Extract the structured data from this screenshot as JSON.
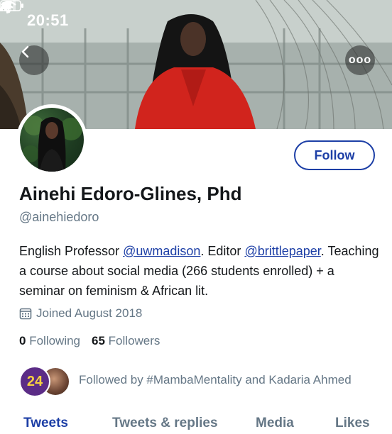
{
  "status_bar": {
    "time": "20:51"
  },
  "header": {
    "back_icon": "chevron-left-icon",
    "more_icon": "ellipsis-icon",
    "more_label": "ooo"
  },
  "profile": {
    "follow_label": "Follow",
    "name": "Ainehi Edoro-Glines, Phd",
    "handle": "@ainehiedoro",
    "bio": {
      "part1": "English Professor ",
      "mention1": "@uwmadison",
      "part2": ". Editor ",
      "mention2": "@brittlepaper",
      "part3": ". Teaching a course about social media (266 students enrolled) + a seminar on feminism & African lit."
    },
    "joined": "Joined August 2018",
    "following_count": "0",
    "following_label": "Following",
    "followers_count": "65",
    "followers_label": "Followers",
    "followed_by": "Followed by #MambaMentality and Kadaria Ahmed",
    "follower_badge_text": "24"
  },
  "tabs": [
    {
      "label": "Tweets",
      "active": true
    },
    {
      "label": "Tweets & replies",
      "active": false
    },
    {
      "label": "Media",
      "active": false
    },
    {
      "label": "Likes",
      "active": false
    }
  ],
  "colors": {
    "accent": "#1d3fa6",
    "secondary_text": "#657786",
    "primary_text": "#14171a"
  }
}
